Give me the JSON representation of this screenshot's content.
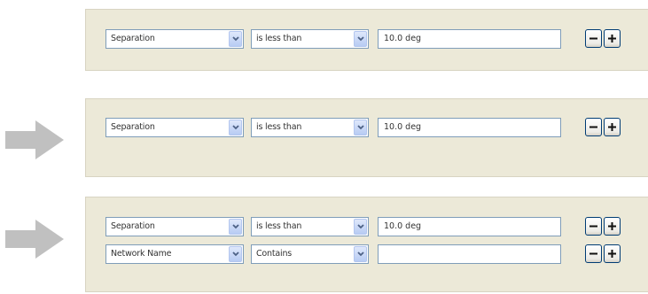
{
  "panels": [
    {
      "rows": [
        {
          "field": "Separation",
          "operator": "is less than",
          "value": "10.0 deg"
        }
      ]
    },
    {
      "rows": [
        {
          "field": "Separation",
          "operator": "is less than",
          "value": "10.0 deg"
        }
      ]
    },
    {
      "rows": [
        {
          "field": "Separation",
          "operator": "is less than",
          "value": "10.0 deg"
        },
        {
          "field": "Network Name",
          "operator": "Contains",
          "value": ""
        }
      ]
    }
  ],
  "icons": {
    "arrow": "right-arrow-icon",
    "dropdown": "chevron-down-icon",
    "remove": "minus-icon",
    "add": "plus-icon"
  },
  "colors": {
    "panel_background": "#ece9d8",
    "arrow": "#c0c0c0",
    "field_border": "#7f9db9",
    "button_border": "#003c74"
  }
}
